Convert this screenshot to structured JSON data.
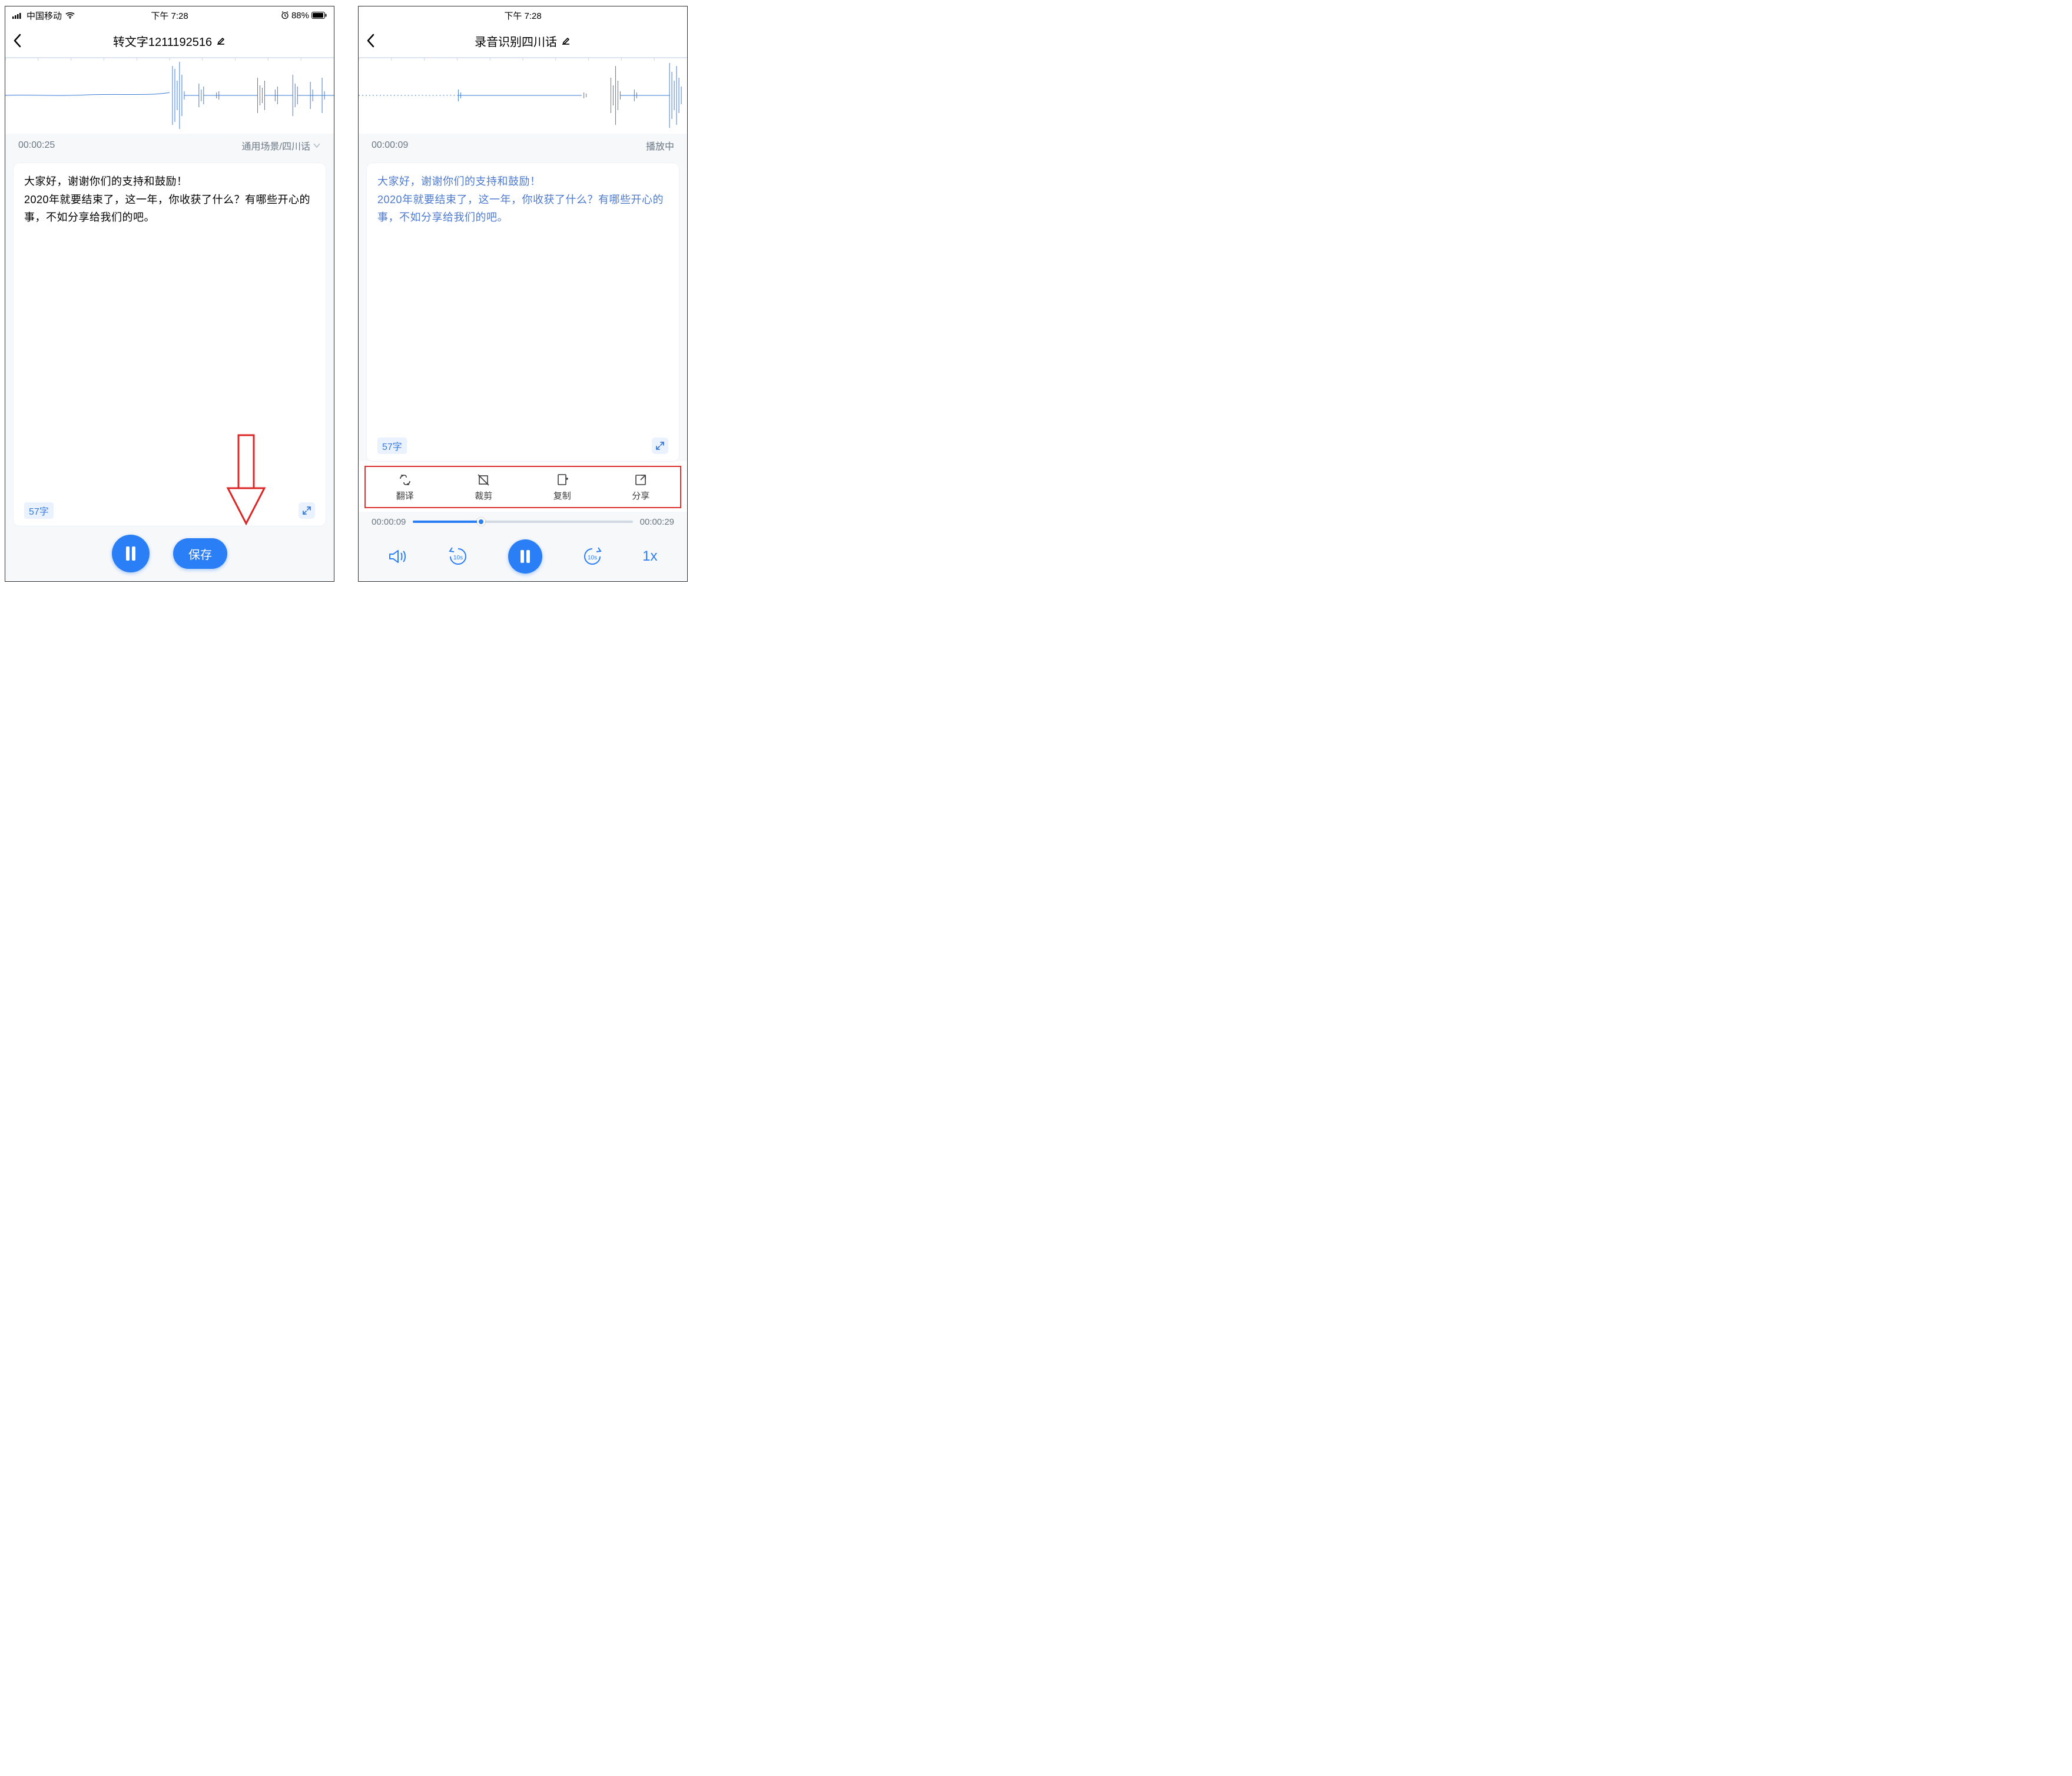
{
  "left": {
    "statusbar": {
      "carrier": "中国移动",
      "time": "下午 7:28",
      "battery": "88%"
    },
    "title": "转文字1211192516",
    "time_code": "00:00:25",
    "scene_label": "通用场景/四川话",
    "transcript_line1": "大家好，谢谢你们的支持和鼓励！",
    "transcript_line2": "2020年就要结束了，这一年，你收获了什么？有哪些开心的事，不如分享给我们的吧。",
    "word_count": "57字",
    "save_label": "保存"
  },
  "right": {
    "statusbar": {
      "time": "下午 7:28"
    },
    "title": "录音识别四川话",
    "time_code": "00:00:09",
    "status_label": "播放中",
    "transcript_line1": "大家好，谢谢你们的支持和鼓励！",
    "transcript_line2": "2020年就要结束了，这一年，你收获了什么？有哪些开心的事，不如分享给我们的吧。",
    "word_count": "57字",
    "actions": {
      "translate": "翻译",
      "crop": "裁剪",
      "copy": "复制",
      "share": "分享"
    },
    "progress": {
      "current": "00:00:09",
      "total": "00:00:29",
      "percent": 31
    },
    "speed": "1x"
  }
}
